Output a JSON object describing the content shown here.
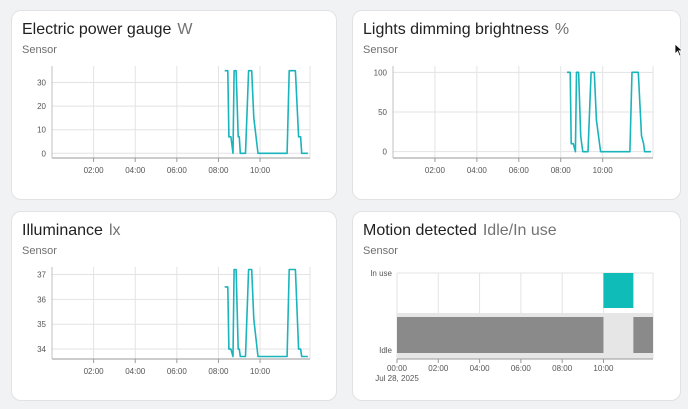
{
  "cards": [
    {
      "title": "Electric power gauge",
      "unit": "W",
      "subtitle": "Sensor",
      "chart_data": {
        "type": "line",
        "xlabel": "",
        "ylabel": "",
        "x_ticks": [
          "02:00",
          "04:00",
          "06:00",
          "08:00",
          "10:00"
        ],
        "y_ticks": [
          "0",
          "10",
          "20",
          "30"
        ],
        "ylim": [
          -2,
          37
        ],
        "xlim": [
          0,
          12.4
        ],
        "grid": true,
        "color": "#1ab4bc",
        "x": [
          8.3,
          8.45,
          8.5,
          8.6,
          8.7,
          8.75,
          8.85,
          8.95,
          9.0,
          9.05,
          9.3,
          9.45,
          9.6,
          9.7,
          9.9,
          10.05,
          10.1,
          10.3,
          10.6,
          10.9,
          11.3,
          11.4,
          11.7,
          11.85,
          11.95,
          12.0,
          12.05,
          12.3
        ],
        "values": [
          35,
          35,
          7,
          7,
          0,
          35,
          35,
          7,
          7,
          0,
          0,
          35,
          35,
          15,
          0,
          0,
          0,
          0,
          0,
          0,
          0,
          35,
          35,
          7,
          7,
          0,
          0,
          0
        ]
      }
    },
    {
      "title": "Lights dimming brightness",
      "unit": "%",
      "subtitle": "Sensor",
      "chart_data": {
        "type": "line",
        "xlabel": "",
        "ylabel": "",
        "x_ticks": [
          "02:00",
          "04:00",
          "06:00",
          "08:00",
          "10:00"
        ],
        "y_ticks": [
          "0",
          "50",
          "100"
        ],
        "ylim": [
          -8,
          108
        ],
        "xlim": [
          0,
          12.4
        ],
        "grid": true,
        "color": "#1ab4bc",
        "x": [
          8.3,
          8.45,
          8.5,
          8.6,
          8.7,
          8.75,
          8.85,
          8.95,
          9.0,
          9.05,
          9.3,
          9.45,
          9.6,
          9.7,
          9.9,
          10.05,
          10.1,
          10.3,
          10.6,
          10.9,
          11.3,
          11.4,
          11.7,
          11.85,
          11.95,
          12.0,
          12.05,
          12.3
        ],
        "values": [
          100,
          100,
          10,
          10,
          0,
          100,
          100,
          20,
          10,
          0,
          0,
          100,
          100,
          40,
          0,
          0,
          0,
          0,
          0,
          0,
          0,
          100,
          100,
          20,
          10,
          0,
          0,
          0
        ]
      }
    },
    {
      "title": "Illuminance",
      "unit": "lx",
      "subtitle": "Sensor",
      "chart_data": {
        "type": "line",
        "xlabel": "",
        "ylabel": "",
        "x_ticks": [
          "02:00",
          "04:00",
          "06:00",
          "08:00",
          "10:00"
        ],
        "y_ticks": [
          "34",
          "35",
          "36",
          "37"
        ],
        "ylim": [
          33.6,
          37.3
        ],
        "xlim": [
          0,
          12.4
        ],
        "grid": true,
        "color": "#1ab4bc",
        "x": [
          8.3,
          8.45,
          8.5,
          8.6,
          8.7,
          8.75,
          8.85,
          8.95,
          9.0,
          9.05,
          9.3,
          9.45,
          9.6,
          9.7,
          9.9,
          10.05,
          10.1,
          10.3,
          10.6,
          10.9,
          11.3,
          11.4,
          11.7,
          11.85,
          11.95,
          12.0,
          12.05,
          12.3
        ],
        "values": [
          36.5,
          36.5,
          34,
          34,
          33.7,
          37.2,
          37.2,
          34,
          34,
          33.7,
          33.7,
          37.2,
          37.2,
          35.2,
          33.7,
          33.7,
          33.7,
          33.7,
          33.7,
          33.7,
          33.7,
          37.2,
          37.2,
          34,
          34,
          33.7,
          33.7,
          33.7
        ]
      }
    },
    {
      "title": "Motion detected",
      "unit": "Idle/In use",
      "subtitle": "Sensor",
      "chart_data": {
        "type": "area",
        "xlabel": "",
        "ylabel": "",
        "x_ticks": [
          "00:00",
          "02:00",
          "04:00",
          "06:00",
          "08:00",
          "10:00"
        ],
        "x_subtick": "Jul 28, 2025",
        "y_ticks": [
          "Idle",
          "In use"
        ],
        "xlim": [
          0,
          12.4
        ],
        "grid": true,
        "states": [
          {
            "state": "Idle",
            "start": 0,
            "end": 10.0
          },
          {
            "state": "In use",
            "start": 10.0,
            "end": 11.45
          },
          {
            "state": "Idle",
            "start": 11.45,
            "end": 12.4
          }
        ],
        "colors": {
          "idle": "#8a8a8a",
          "in_use": "#0fbcb8",
          "idle_light": "#e6e6e6"
        }
      }
    }
  ]
}
